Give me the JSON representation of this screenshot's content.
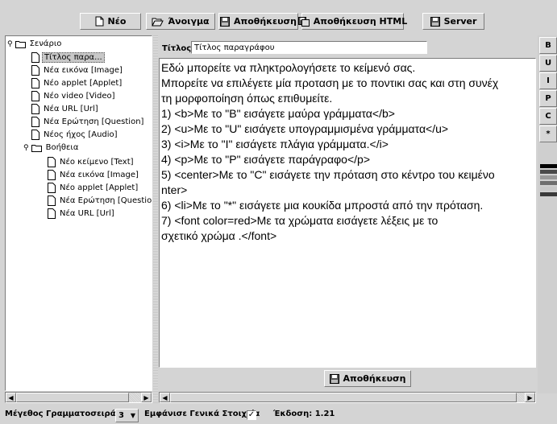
{
  "toolbar": {
    "new_label": "Νέο",
    "open_label": "Άνοιγμα",
    "save_label": "Αποθήκευση",
    "save_html_label": "Αποθήκευση HTML",
    "server_label": "Server"
  },
  "tree": {
    "items": [
      {
        "label": "Σενάριο",
        "type": "folder"
      },
      {
        "label": "Τίτλος παρα...",
        "type": "file",
        "selected": true
      },
      {
        "label": "Νέα εικόνα [Image]",
        "type": "file"
      },
      {
        "label": "Νέο applet [Applet]",
        "type": "file"
      },
      {
        "label": "Νέο video [Video]",
        "type": "file"
      },
      {
        "label": "Νέα URL [Url]",
        "type": "file"
      },
      {
        "label": "Νέα Ερώτηση [Question]",
        "type": "file"
      },
      {
        "label": "Νέος ήχος [Audio]",
        "type": "file"
      },
      {
        "label": "Βοήθεια",
        "type": "folder"
      },
      {
        "label": "Νέο κείμενο [Text]",
        "type": "file"
      },
      {
        "label": "Νέα εικόνα [Image]",
        "type": "file"
      },
      {
        "label": "Νέο applet [Applet]",
        "type": "file"
      },
      {
        "label": "Νέα Ερώτηση [Questio",
        "type": "file"
      },
      {
        "label": "Νέα URL [Url]",
        "type": "file"
      }
    ]
  },
  "editor": {
    "title_label": "Τίτλος:",
    "title_value": "Τίτλος παραγράφου",
    "lines": [
      "Εδώ μπορείτε να πληκτρολογήσετε το κείμενό σας.",
      "Μπορείτε να επιλέγετε μία προταση με το ποντικι σας και στη συνέχ",
      "τη μορφοποίηση όπως επιθυμείτε.",
      "1) <b>Με το \"B\" εισάγετε μαύρα γράμματα</b>",
      "2) <u>Με το \"U\" εισάγετε υπογραμμισμένα γράμματα</u>",
      "3) <i>Με το \"I\" εισάγετε πλάγια γράμματα.</i>",
      "4) <p>Με το \"P\" εισάγετε παράγραφο</p>",
      "5) <center>Με το \"C\" εισάγετε την πρόταση στο κέντρο του κειμένο",
      "nter>",
      "6) <li>Με το \"*\" εισάγετε μια κουκίδα μπροστά από την πρόταση.",
      "7) <font color=red>Με τα χρώματα εισάγετε λέξεις με το",
      "σχετικό χρώμα .</font>"
    ],
    "save_label": "Αποθήκευση"
  },
  "format_buttons": [
    "B",
    "U",
    "I",
    "P",
    "C",
    "*"
  ],
  "color_swatches": [
    "#000000",
    "#4a4a4a",
    "#999999",
    "#6e6e6e",
    "#c8c8c8",
    "#3a3a3a"
  ],
  "status": {
    "font_size_label": "Μέγεθος Γραμματοσειράς:",
    "font_size_value": "3",
    "show_general_label": "Εμφάνισε Γενικά Στοιχεία",
    "show_general_checked": true,
    "version_label": "Έκδοση: 1.21"
  }
}
